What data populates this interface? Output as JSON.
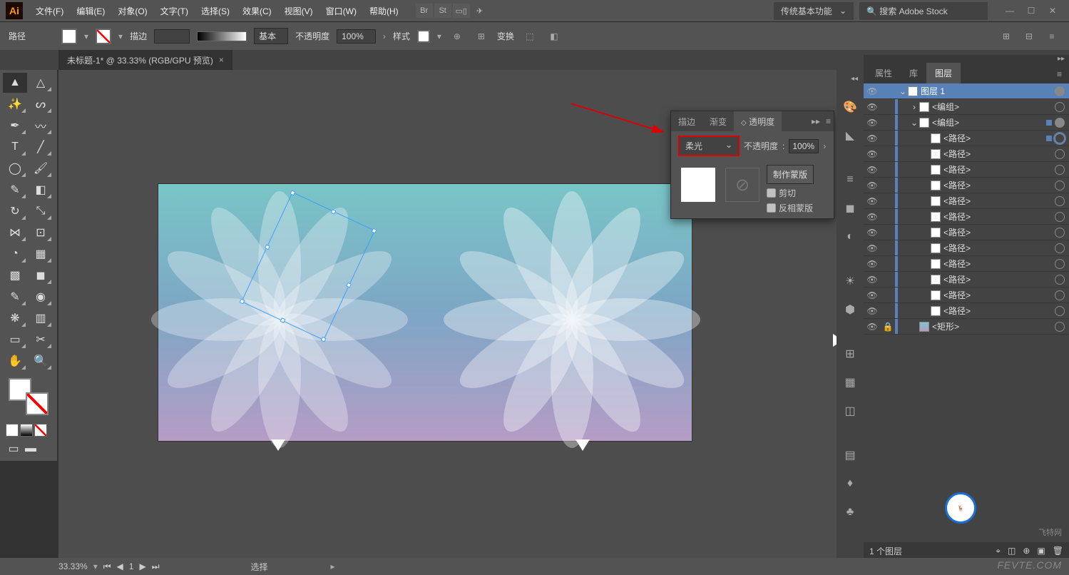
{
  "app_icon": "Ai",
  "menu": [
    "文件(F)",
    "编辑(E)",
    "对象(O)",
    "文字(T)",
    "选择(S)",
    "效果(C)",
    "视图(V)",
    "窗口(W)",
    "帮助(H)"
  ],
  "menubar_icons": [
    "Br",
    "St"
  ],
  "workspace": "传统基本功能",
  "search_placeholder": "搜索 Adobe Stock",
  "options": {
    "tool_label": "路径",
    "stroke_label": "描边",
    "stroke_pt": "",
    "profile_label": "基本",
    "opacity_label": "不透明度",
    "opacity_value": "100%",
    "style_label": "样式",
    "transform_label": "变换"
  },
  "doc_tab": "未标题-1* @ 33.33% (RGB/GPU 预览)",
  "transparency": {
    "tabs": [
      "描边",
      "渐变",
      "透明度"
    ],
    "blend_mode": "柔光",
    "opacity_label": "不透明度",
    "opacity_value": "100%",
    "make_mask": "制作蒙版",
    "clip": "剪切",
    "invert": "反相蒙版"
  },
  "panel_tabs": [
    "属性",
    "库",
    "图层"
  ],
  "layers": [
    {
      "name": "图层 1",
      "indent": 0,
      "top": true,
      "toggle": "⌄",
      "target": "filled",
      "sel": true
    },
    {
      "name": "<编组>",
      "indent": 1,
      "toggle": "›",
      "target": "open"
    },
    {
      "name": "<编组>",
      "indent": 1,
      "toggle": "⌄",
      "target": "filled",
      "sel": true
    },
    {
      "name": "<路径>",
      "indent": 2,
      "target": "ring",
      "sel": true
    },
    {
      "name": "<路径>",
      "indent": 2,
      "target": "open"
    },
    {
      "name": "<路径>",
      "indent": 2,
      "target": "open"
    },
    {
      "name": "<路径>",
      "indent": 2,
      "target": "open"
    },
    {
      "name": "<路径>",
      "indent": 2,
      "target": "open"
    },
    {
      "name": "<路径>",
      "indent": 2,
      "target": "open"
    },
    {
      "name": "<路径>",
      "indent": 2,
      "target": "open"
    },
    {
      "name": "<路径>",
      "indent": 2,
      "target": "open"
    },
    {
      "name": "<路径>",
      "indent": 2,
      "target": "open"
    },
    {
      "name": "<路径>",
      "indent": 2,
      "target": "open"
    },
    {
      "name": "<路径>",
      "indent": 2,
      "target": "open"
    },
    {
      "name": "<路径>",
      "indent": 2,
      "target": "open"
    },
    {
      "name": "<矩形>",
      "indent": 1,
      "lock": true,
      "target": "open",
      "thumb": "gradient"
    }
  ],
  "layer_count": "1 个图层",
  "status": {
    "zoom": "33.33%",
    "page": "1",
    "mode": "选择"
  },
  "watermark": "飞特网",
  "watermark_site": "FEVTE.COM"
}
